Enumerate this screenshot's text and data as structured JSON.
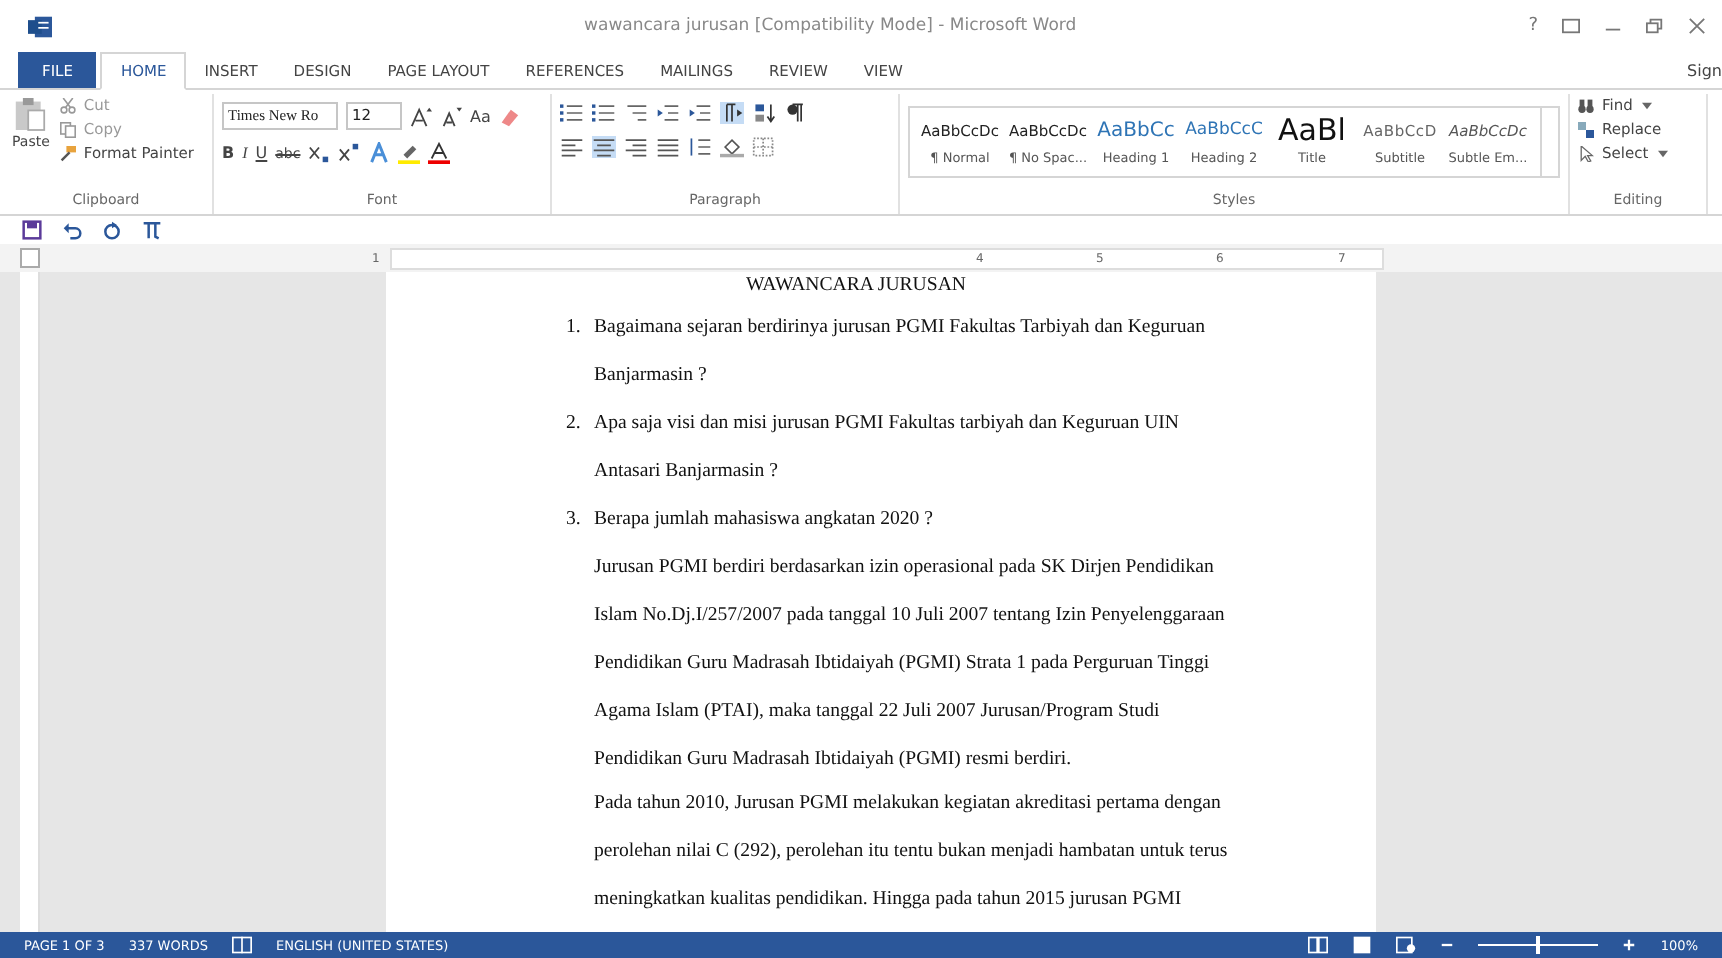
{
  "window": {
    "title": "wawancara jurusan [Compatibility Mode] - Microsoft Word",
    "help": "?",
    "sign_in": "Sign"
  },
  "tabs": [
    {
      "label": "FILE",
      "kind": "file",
      "selected": false
    },
    {
      "label": "HOME",
      "kind": "tab",
      "selected": true
    },
    {
      "label": "INSERT",
      "kind": "tab",
      "selected": false
    },
    {
      "label": "DESIGN",
      "kind": "tab",
      "selected": false
    },
    {
      "label": "PAGE LAYOUT",
      "kind": "tab",
      "selected": false
    },
    {
      "label": "REFERENCES",
      "kind": "tab",
      "selected": false
    },
    {
      "label": "MAILINGS",
      "kind": "tab",
      "selected": false
    },
    {
      "label": "REVIEW",
      "kind": "tab",
      "selected": false
    },
    {
      "label": "VIEW",
      "kind": "tab",
      "selected": false
    }
  ],
  "clipboard": {
    "label": "Clipboard",
    "paste": "Paste",
    "cut": "Cut",
    "copy": "Copy",
    "format_painter": "Format Painter"
  },
  "font": {
    "label": "Font",
    "font_name": "Times New Ro",
    "font_size": "12",
    "case_button": "Aa",
    "bold": "B",
    "italic": "I",
    "underline": "U",
    "strikethrough": "abc"
  },
  "paragraph": {
    "label": "Paragraph",
    "alignment": [
      {
        "selected": false
      },
      {
        "selected": true
      },
      {
        "selected": false
      },
      {
        "selected": false
      }
    ]
  },
  "styles": {
    "label": "Styles",
    "items": [
      {
        "preview": "AaBbCcDc",
        "name": "¶ Normal",
        "kind": "normal"
      },
      {
        "preview": "AaBbCcDc",
        "name": "¶ No Spac...",
        "kind": "normal"
      },
      {
        "preview": "AaBbCc",
        "name": "Heading 1",
        "kind": "heading1"
      },
      {
        "preview": "AaBbCcC",
        "name": "Heading 2",
        "kind": "heading2"
      },
      {
        "preview": "AaBl",
        "name": "Title",
        "kind": "title"
      },
      {
        "preview": "AaBbCcD",
        "name": "Subtitle",
        "kind": "subtitle"
      },
      {
        "preview": "AaBbCcDc",
        "name": "Subtle Em...",
        "kind": "emphasis"
      }
    ]
  },
  "editing": {
    "label": "Editing",
    "find": "Find",
    "replace": "Replace",
    "select": "Select"
  },
  "ruler": {
    "labels": [
      "1",
      "4",
      "5",
      "6",
      "7"
    ]
  },
  "document": {
    "title": "WAWANCARA JURUSAN",
    "lines": [
      {
        "kind": "numbered",
        "number": "1.",
        "text": "Bagaimana sejaran berdirinya jurusan PGMI Fakultas Tarbiyah dan Keguruan"
      },
      {
        "kind": "body",
        "text": "Banjarmasin ?"
      },
      {
        "kind": "numbered",
        "number": "2.",
        "text": "Apa saja visi dan misi jurusan PGMI Fakultas tarbiyah dan Keguruan UIN"
      },
      {
        "kind": "body",
        "text": "Antasari Banjarmasin ?"
      },
      {
        "kind": "numbered",
        "number": "3.",
        "text": "Berapa jumlah mahasiswa angkatan 2020 ?"
      },
      {
        "kind": "body",
        "text": "Jurusan PGMI berdiri berdasarkan izin operasional pada SK Dirjen Pendidikan"
      },
      {
        "kind": "body",
        "text": "Islam No.Dj.I/257/2007 pada tanggal 10 Juli 2007 tentang Izin Penyelenggaraan"
      },
      {
        "kind": "body",
        "text": "Pendidikan Guru Madrasah Ibtidaiyah (PGMI) Strata 1 pada Perguruan Tinggi"
      },
      {
        "kind": "body",
        "text": "Agama Islam (PTAI), maka tanggal 22 Juli 2007 Jurusan/Program Studi"
      },
      {
        "kind": "body",
        "text": "Pendidikan Guru Madrasah Ibtidaiyah (PGMI) resmi berdiri."
      },
      {
        "kind": "tight",
        "text": "Pada tahun 2010, Jurusan PGMI melakukan kegiatan akreditasi pertama dengan"
      },
      {
        "kind": "body",
        "text": "perolehan nilai C (292), perolehan itu tentu bukan menjadi hambatan untuk terus"
      },
      {
        "kind": "body",
        "text": "meningkatkan kualitas pendidikan. Hingga pada tahun 2015 jurusan PGMI"
      }
    ]
  },
  "status_bar": {
    "page": "PAGE 1 OF 3",
    "words": "337 WORDS",
    "language": "ENGLISH (UNITED STATES)",
    "zoom": "100%",
    "zoom_slider": {
      "level": 0.5
    }
  }
}
